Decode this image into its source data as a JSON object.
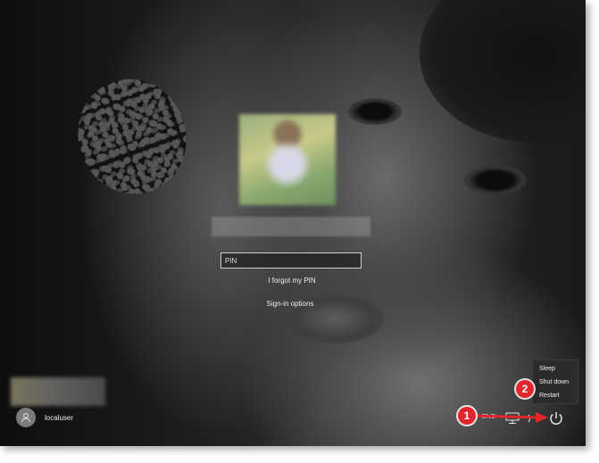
{
  "login": {
    "pin_placeholder": "PIN",
    "forgot_pin": "I forgot my PIN",
    "sign_in_options": "Sign-in options"
  },
  "user_switcher": {
    "local_user_name": "localuser"
  },
  "tray": {
    "language": "ENG",
    "icons": [
      "network-icon",
      "ease-of-access-icon",
      "power-icon"
    ]
  },
  "power_menu": {
    "items": [
      "Sleep",
      "Shut down",
      "Restart"
    ]
  },
  "callouts": {
    "first": "1",
    "second": "2"
  },
  "colors": {
    "callout": "#e1262c",
    "menu_background": "#2b2b2b",
    "text": "#f0f0f0"
  }
}
